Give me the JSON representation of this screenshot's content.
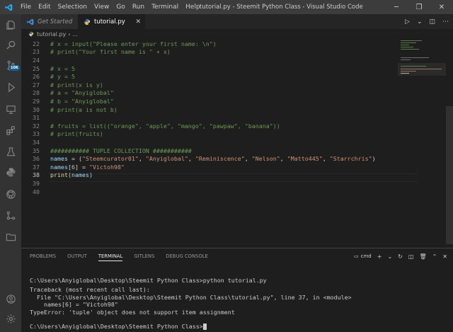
{
  "titlebar": {
    "menu": [
      "File",
      "Edit",
      "Selection",
      "View",
      "Go",
      "Run",
      "Terminal",
      "Help"
    ],
    "title": "tutorial.py - Steemit Python Class - Visual Studio Code"
  },
  "activity": {
    "badge": "10K"
  },
  "tabs": [
    {
      "label": "Get Started"
    },
    {
      "label": "tutorial.py"
    }
  ],
  "breadcrumb": {
    "file": "tutorial.py",
    "more": "..."
  },
  "editor": {
    "lines": [
      {
        "n": "22",
        "tokens": [
          [
            "c",
            "# x = input(\"Please enter your first name: \\n\")"
          ]
        ]
      },
      {
        "n": "23",
        "tokens": [
          [
            "c",
            "# print(\"Your first name is \" + x)"
          ]
        ]
      },
      {
        "n": "24",
        "tokens": []
      },
      {
        "n": "25",
        "tokens": [
          [
            "c",
            "# x = 5"
          ]
        ]
      },
      {
        "n": "26",
        "tokens": [
          [
            "c",
            "# y = 5"
          ]
        ]
      },
      {
        "n": "27",
        "tokens": [
          [
            "c",
            "# print(x is y)"
          ]
        ]
      },
      {
        "n": "28",
        "tokens": [
          [
            "c",
            "# a = \"Anyiglobal\""
          ]
        ]
      },
      {
        "n": "29",
        "tokens": [
          [
            "c",
            "# b = \"Anyiglobal\""
          ]
        ]
      },
      {
        "n": "30",
        "tokens": [
          [
            "c",
            "# print(a is not b)"
          ]
        ]
      },
      {
        "n": "31",
        "tokens": []
      },
      {
        "n": "32",
        "tokens": [
          [
            "c",
            "# fruits = list((\"orange\", \"apple\", \"mango\", \"pawpaw\", \"banana\"))"
          ]
        ]
      },
      {
        "n": "33",
        "tokens": [
          [
            "c",
            "# print(fruits)"
          ]
        ]
      },
      {
        "n": "34",
        "tokens": []
      },
      {
        "n": "35",
        "tokens": [
          [
            "c",
            "########### TUPLE COLLECTION ###########"
          ]
        ]
      },
      {
        "n": "36",
        "tokens": [
          [
            "v",
            "names"
          ],
          [
            "o",
            " = ("
          ],
          [
            "s",
            "\"Steemcurator01\""
          ],
          [
            "o",
            ", "
          ],
          [
            "s",
            "\"Anyiglobal\""
          ],
          [
            "o",
            ", "
          ],
          [
            "s",
            "\"Reminiscence\""
          ],
          [
            "o",
            ", "
          ],
          [
            "s",
            "\"Nelson\""
          ],
          [
            "o",
            ", "
          ],
          [
            "s",
            "\"Matto445\""
          ],
          [
            "o",
            ", "
          ],
          [
            "s",
            "\"Starrchris\""
          ],
          [
            "o",
            ")"
          ]
        ]
      },
      {
        "n": "37",
        "tokens": [
          [
            "v",
            "names"
          ],
          [
            "o",
            "["
          ],
          [
            "n",
            "6"
          ],
          [
            "o",
            "] = "
          ],
          [
            "s",
            "\"Victoh98\""
          ]
        ]
      },
      {
        "n": "38",
        "tokens": [
          [
            "f",
            "print"
          ],
          [
            "o",
            "("
          ],
          [
            "v",
            "names"
          ],
          [
            "o",
            ")"
          ]
        ]
      },
      {
        "n": "39",
        "tokens": []
      },
      {
        "n": "40",
        "tokens": []
      }
    ]
  },
  "panel": {
    "tabs": [
      "PROBLEMS",
      "OUTPUT",
      "TERMINAL",
      "GITLENS",
      "DEBUG CONSOLE"
    ],
    "active_tab": "TERMINAL",
    "shell": "cmd",
    "terminal": [
      "C:\\Users\\Anyiglobal\\Desktop\\Steemit Python Class>python tutorial.py",
      "Traceback (most recent call last):",
      "  File \"C:\\Users\\Anyiglobal\\Desktop\\Steemit Python Class\\tutorial.py\", line 37, in <module>",
      "    names[6] = \"Victoh98\"",
      "TypeError: 'tuple' object does not support item assignment",
      "",
      "C:\\Users\\Anyiglobal\\Desktop\\Steemit Python Class>"
    ]
  },
  "colors": {
    "comment": "#6a9955",
    "variable": "#9cdcfe",
    "string": "#ce9178",
    "number": "#b5cea8",
    "function": "#dcdcaa",
    "accent": "#007acc"
  }
}
